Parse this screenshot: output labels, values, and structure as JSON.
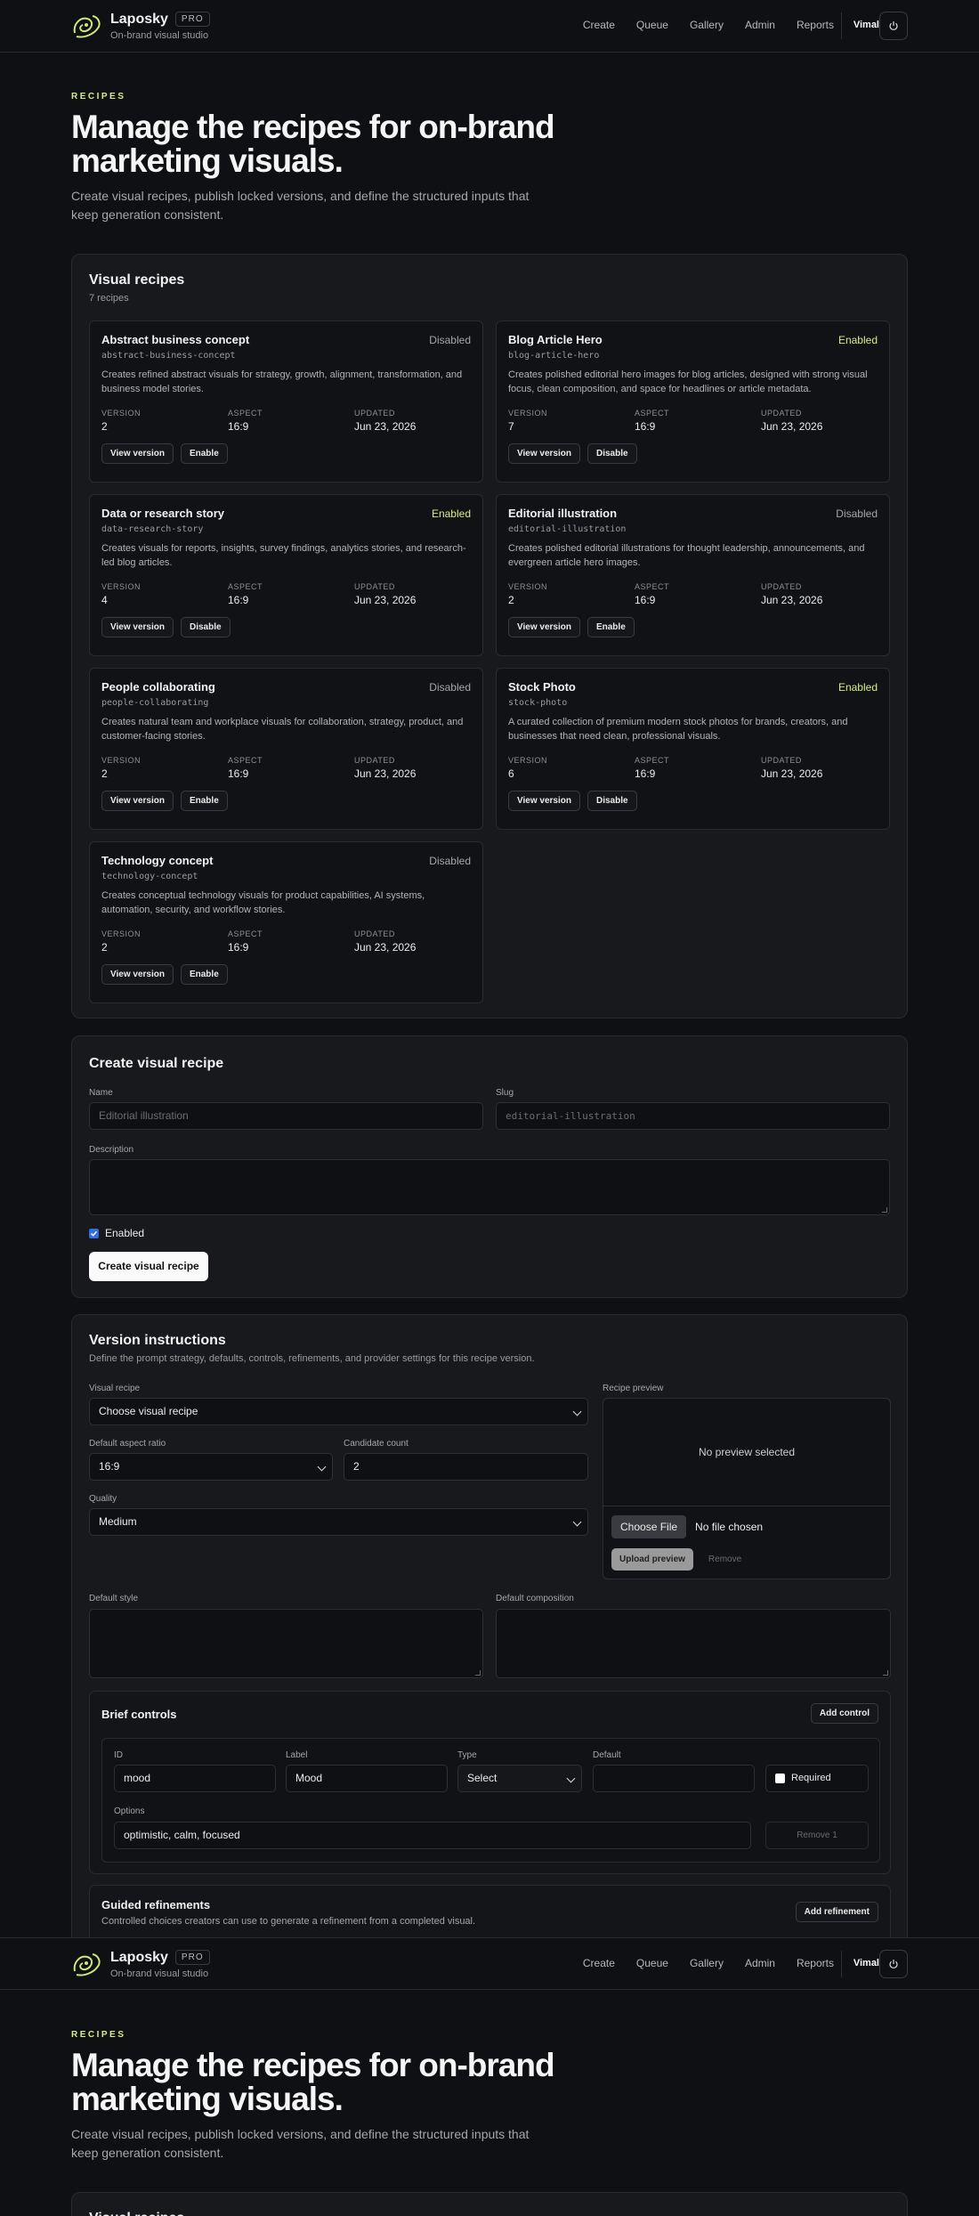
{
  "header": {
    "brand_name": "Laposky",
    "badge": "PRO",
    "tagline": "On-brand visual studio",
    "nav": [
      "Create",
      "Queue",
      "Gallery",
      "Admin",
      "Reports"
    ],
    "user": "Vimal",
    "logout_icon": "power-icon"
  },
  "hero": {
    "eyebrow": "RECIPES",
    "title": "Manage the recipes for on-brand marketing visuals.",
    "subtitle": "Create visual recipes, publish locked versions, and define the structured inputs that keep generation consistent."
  },
  "recipes_panel": {
    "title": "Visual recipes",
    "count": "7 recipes",
    "meta_labels": {
      "version": "VERSION",
      "aspect": "ASPECT",
      "updated": "UPDATED"
    },
    "view_label": "View version",
    "recipes": [
      {
        "name": "Abstract business concept",
        "slug": "abstract-business-concept",
        "status": "Disabled",
        "description": "Creates refined abstract visuals for strategy, growth, alignment, transformation, and business model stories.",
        "version": "2",
        "aspect": "16:9",
        "updated": "Jun 23, 2026",
        "action": "Enable"
      },
      {
        "name": "Blog Article Hero",
        "slug": "blog-article-hero",
        "status": "Enabled",
        "description": "Creates polished editorial hero images for blog articles, designed with strong visual focus, clean composition, and space for headlines or article metadata.",
        "version": "7",
        "aspect": "16:9",
        "updated": "Jun 23, 2026",
        "action": "Disable"
      },
      {
        "name": "Data or research story",
        "slug": "data-research-story",
        "status": "Enabled",
        "description": "Creates visuals for reports, insights, survey findings, analytics stories, and research-led blog articles.",
        "version": "4",
        "aspect": "16:9",
        "updated": "Jun 23, 2026",
        "action": "Disable"
      },
      {
        "name": "Editorial illustration",
        "slug": "editorial-illustration",
        "status": "Disabled",
        "description": "Creates polished editorial illustrations for thought leadership, announcements, and evergreen article hero images.",
        "version": "2",
        "aspect": "16:9",
        "updated": "Jun 23, 2026",
        "action": "Enable"
      },
      {
        "name": "People collaborating",
        "slug": "people-collaborating",
        "status": "Disabled",
        "description": "Creates natural team and workplace visuals for collaboration, strategy, product, and customer-facing stories.",
        "version": "2",
        "aspect": "16:9",
        "updated": "Jun 23, 2026",
        "action": "Enable"
      },
      {
        "name": "Stock Photo",
        "slug": "stock-photo",
        "status": "Enabled",
        "description": "A curated collection of premium modern stock photos for brands, creators, and businesses that need clean, professional visuals.",
        "version": "6",
        "aspect": "16:9",
        "updated": "Jun 23, 2026",
        "action": "Disable"
      },
      {
        "name": "Technology concept",
        "slug": "technology-concept",
        "status": "Disabled",
        "description": "Creates conceptual technology visuals for product capabilities, AI systems, automation, security, and workflow stories.",
        "version": "2",
        "aspect": "16:9",
        "updated": "Jun 23, 2026",
        "action": "Enable"
      }
    ]
  },
  "create_panel": {
    "title": "Create visual recipe",
    "name_label": "Name",
    "name_placeholder": "Editorial illustration",
    "slug_label": "Slug",
    "slug_placeholder": "editorial-illustration",
    "description_label": "Description",
    "enabled_label": "Enabled",
    "enabled_checked": true,
    "submit_label": "Create visual recipe"
  },
  "version_panel": {
    "title": "Version instructions",
    "subtitle": "Define the prompt strategy, defaults, controls, refinements, and provider settings for this recipe version.",
    "recipe_label": "Visual recipe",
    "recipe_value": "Choose visual recipe",
    "aspect_label": "Default aspect ratio",
    "aspect_value": "16:9",
    "count_label": "Candidate count",
    "count_value": "2",
    "quality_label": "Quality",
    "quality_value": "Medium",
    "preview_label": "Recipe preview",
    "preview_empty": "No preview selected",
    "choose_file": "Choose File",
    "no_file": "No file chosen",
    "upload_label": "Upload preview",
    "remove_label": "Remove",
    "style_label": "Default style",
    "composition_label": "Default composition",
    "brief": {
      "title": "Brief controls",
      "add_label": "Add control",
      "id_label": "ID",
      "id_value": "mood",
      "label_label": "Label",
      "label_value": "Mood",
      "type_label": "Type",
      "type_value": "Select",
      "default_label": "Default",
      "default_value": "",
      "required_label": "Required",
      "options_label": "Options",
      "options_value": "optimistic, calm, focused",
      "remove_label": "Remove 1"
    },
    "refinements": {
      "title": "Guided refinements",
      "subtitle": "Controlled choices creators can use to generate a refinement from a completed visual.",
      "add_label": "Add refinement"
    }
  }
}
